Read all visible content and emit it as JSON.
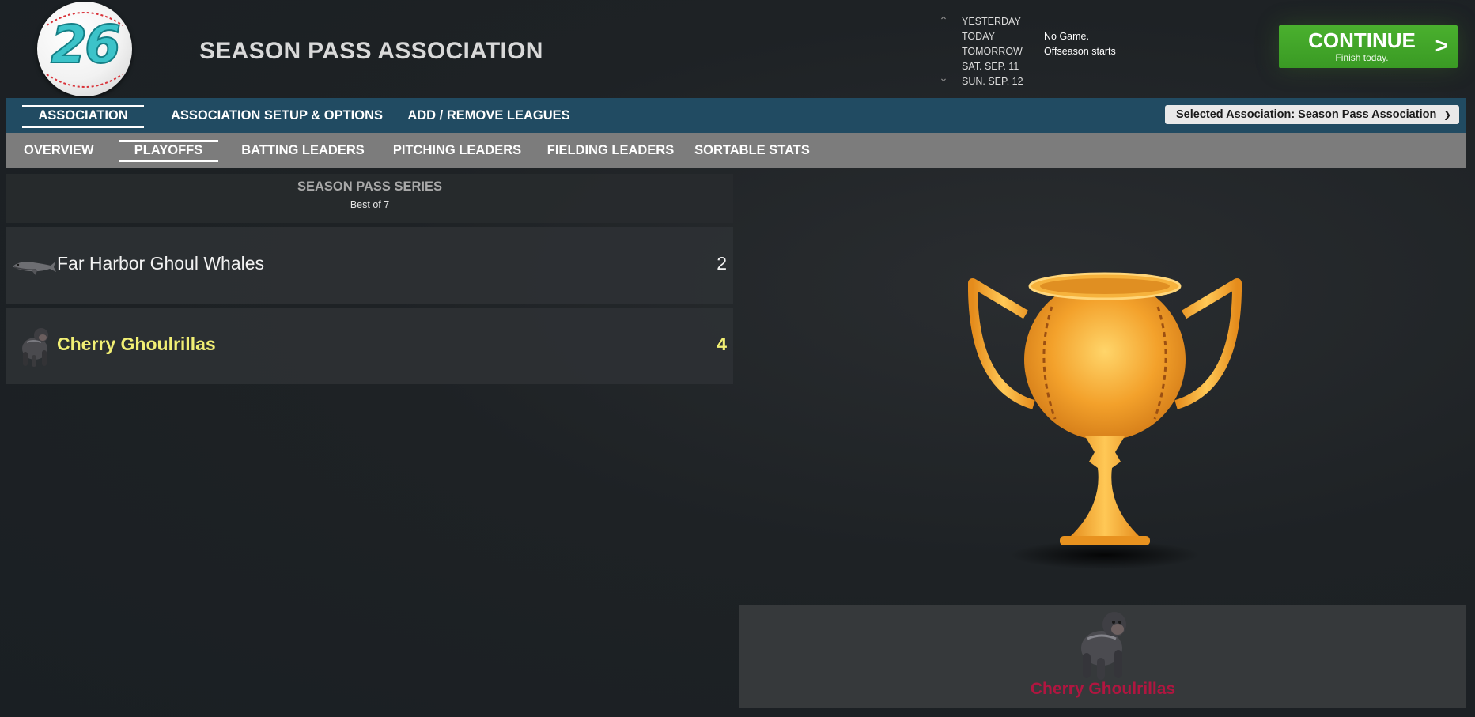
{
  "app": {
    "logo_text": "26",
    "title": "SEASON PASS ASSOCIATION"
  },
  "schedule": [
    {
      "day": "YESTERDAY",
      "event": ""
    },
    {
      "day": "TODAY",
      "event": "No Game."
    },
    {
      "day": "TOMORROW",
      "event": "Offseason starts"
    },
    {
      "day": "SAT. SEP. 11",
      "event": ""
    },
    {
      "day": "SUN. SEP. 12",
      "event": ""
    }
  ],
  "continue_button": {
    "label": "CONTINUE",
    "sublabel": "Finish today.",
    "arrow": ">"
  },
  "nav_primary": [
    {
      "label": "ASSOCIATION",
      "active": true
    },
    {
      "label": "ASSOCIATION SETUP & OPTIONS",
      "active": false
    },
    {
      "label": "ADD / REMOVE LEAGUES",
      "active": false
    }
  ],
  "association_select": {
    "value": "Selected Association: Season Pass Association"
  },
  "nav_secondary": [
    {
      "label": "OVERVIEW",
      "active": false
    },
    {
      "label": "PLAYOFFS",
      "active": true
    },
    {
      "label": "BATTING LEADERS",
      "active": false
    },
    {
      "label": "PITCHING LEADERS",
      "active": false
    },
    {
      "label": "FIELDING LEADERS",
      "active": false
    },
    {
      "label": "SORTABLE STATS",
      "active": false
    }
  ],
  "series": {
    "title": "SEASON PASS SERIES",
    "subtitle": "Best of 7",
    "teams": [
      {
        "name": "Far Harbor Ghoul Whales",
        "wins": "2",
        "logo": "whale-logo",
        "winner": false
      },
      {
        "name": "Cherry Ghoulrillas",
        "wins": "4",
        "logo": "gorilla-logo",
        "winner": true
      }
    ]
  },
  "champion": {
    "name": "Cherry Ghoulrillas",
    "logo": "gorilla-logo",
    "trophy": "baseball-trophy-icon"
  },
  "colors": {
    "nav_primary_bg": "#214b62",
    "nav_secondary_bg": "#7c7c7c",
    "continue_green": "#3fa628",
    "winner_yellow": "#f1ef74",
    "champion_red": "#b01640",
    "trophy_gold": "#f0a62a"
  }
}
